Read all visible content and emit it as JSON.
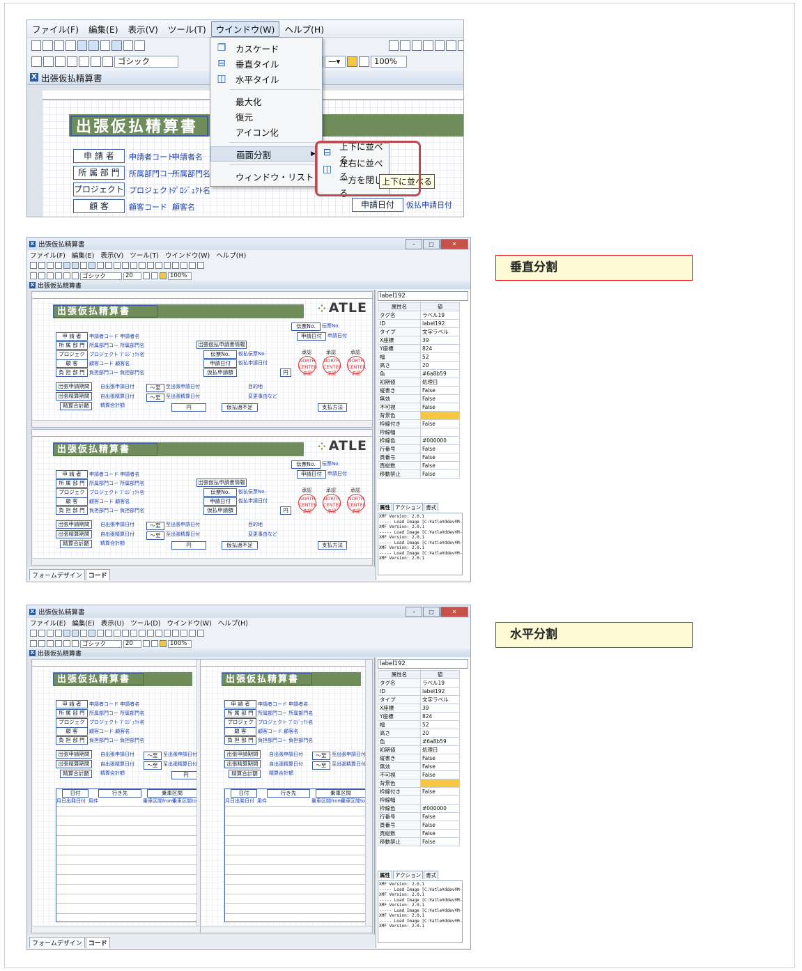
{
  "menubar": [
    "ファイル(F)",
    "編集(E)",
    "表示(V)",
    "ツール(T)",
    "ウインドウ(W)",
    "ヘルプ(H)"
  ],
  "active_menu": "ウインドウ(W)",
  "font_combo": "ゴシック",
  "zoom_combo": "100%",
  "doc_title": "出張仮払精算書",
  "window_menu": {
    "items": [
      {
        "label": "カスケード",
        "icon": "cascade-icon"
      },
      {
        "label": "垂直タイル",
        "icon": "tile-vertical-icon"
      },
      {
        "label": "水平タイル",
        "icon": "tile-horizontal-icon"
      },
      {
        "label": "最大化"
      },
      {
        "label": "復元"
      },
      {
        "label": "アイコン化"
      },
      {
        "label": "画面分割"
      },
      {
        "label": "ウィンドウ・リスト"
      }
    ]
  },
  "split_submenu": {
    "items": [
      {
        "label": "上下に並べる",
        "icon": "split-horizontal-icon"
      },
      {
        "label": "左右に並べる",
        "icon": "split-vertical-icon"
      },
      {
        "label": "一方を閉じる"
      }
    ],
    "tooltip": "上下に並べる"
  },
  "form": {
    "title": "出張仮払精算書",
    "labels": [
      "申 請 者",
      "所 属 部 門",
      "プロジェクト",
      "顧 客"
    ],
    "values": [
      [
        "申請者コード",
        "申請者名"
      ],
      [
        "所属部門コー",
        "所属部門名"
      ],
      [
        "プロジェクト",
        "ﾌﾟﾛｼﾞｪｸﾄ名"
      ],
      [
        "顧客コード",
        "顧客名"
      ]
    ],
    "apply_date_label": "申請日付",
    "apply_date_value": "仮払申請日付"
  },
  "mini": {
    "labels": [
      "申 請 者",
      "所 属 部 門",
      "プロジェクト",
      "顧 客",
      "負 担 部 門"
    ],
    "values": [
      "申請者コード 申請者名",
      "所属部門コー 所属部門名",
      "プロジェクト ﾌﾟﾛｼﾞｪｸﾄ名",
      "顧客コード 顧客名",
      "負担部門コー 負担部門名"
    ],
    "period_labels": [
      "出張申請期間",
      "出張精算期間",
      "精算合計額"
    ],
    "period_values": [
      "自出張申請日付",
      "自出張精算日付",
      "精算合計額"
    ],
    "to_labels": [
      "～至",
      "～至"
    ],
    "to_values": [
      "至出張申請日付",
      "至出張精算日付"
    ],
    "yen": "円",
    "atle": "ATLE",
    "settle_info": "出張仮払申請書情報",
    "denpyo_label": "伝票No.",
    "denpyo_value": "伝票No.",
    "apply_date": "申請日付",
    "apply_date_value": "申請日付",
    "kari_denpyo": "仮払伝票No.",
    "kari_apply": "仮払申請日付",
    "kari_amount": "仮払申請額",
    "stamps": [
      "NORTH CENTER 承認",
      "NORTH CENTER 承認",
      "NORTH CENTER 承認"
    ],
    "stamp_heads": [
      "承認",
      "承認",
      "承認"
    ],
    "destination_label": "目的地",
    "reason_label": "変更事由など",
    "shortage": "仮払過不足",
    "pay_method": "支払方法",
    "table_headers": [
      "日付",
      "行き先",
      "乗車区間"
    ],
    "table_sub": [
      "月日",
      "出発日付",
      "用件",
      "乗車区間from",
      "乗車区間to"
    ]
  },
  "app": {
    "title": "出張仮払精算書",
    "menu": [
      "ファイル(F)",
      "編集(E)",
      "表示(V)",
      "ツール(T)",
      "ウインドウ(W)",
      "ヘルプ(H)"
    ],
    "menu_w3": [
      "ファイル(E)",
      "編集(E)",
      "表示(U)",
      "ツール(D)",
      "ウインドウ(W)",
      "ヘルプ(H)"
    ],
    "font": "ゴシック",
    "size": "20",
    "zoom": "100%",
    "tabs": [
      "フォームデザイン",
      "コード"
    ],
    "prop_select": "label192",
    "prop_header": [
      "属性名",
      "値"
    ],
    "props": [
      [
        "タグ名",
        "ラベル19"
      ],
      [
        "ID",
        "label192"
      ],
      [
        "タイプ",
        "文字ラベル"
      ],
      [
        "X座標",
        "39"
      ],
      [
        "Y座標",
        "824"
      ],
      [
        "幅",
        "52"
      ],
      [
        "高さ",
        "20"
      ],
      [
        "色",
        "#6a8b59"
      ],
      [
        "初期値",
        "処理日"
      ],
      [
        "縦書き",
        "False"
      ],
      [
        "無効",
        "False"
      ],
      [
        "不可視",
        "False"
      ],
      [
        "背景色",
        ""
      ],
      [
        "枠線付き",
        "False"
      ],
      [
        "枠線幅",
        ""
      ],
      [
        "枠線色",
        "#000000"
      ],
      [
        "行番号",
        "False"
      ],
      [
        "頁番号",
        "False"
      ],
      [
        "頁総数",
        "False"
      ],
      [
        "移動禁止",
        "False"
      ]
    ],
    "prop_tabs": [
      "属性",
      "アクション",
      "書式"
    ],
    "log": "XMF Version: 2.0.1\n----- Load Image [C:¥atle¥ddev¥M-¥mbf\nXMF Version: 2.0.1\n----- Load Image [C:¥atle¥ddev¥M-¥mbf\nXMF Version: 2.0.1\n----- Load Image [C:¥atle¥ddev¥M-¥mbf\nXMF Version: 2.0.1\n----- Load Image [C:¥atle¥ddev¥M-¥mbf\nXMF Version: 2.0.1"
  },
  "callouts": {
    "vertical": "垂直分割",
    "horizontal": "水平分割"
  }
}
